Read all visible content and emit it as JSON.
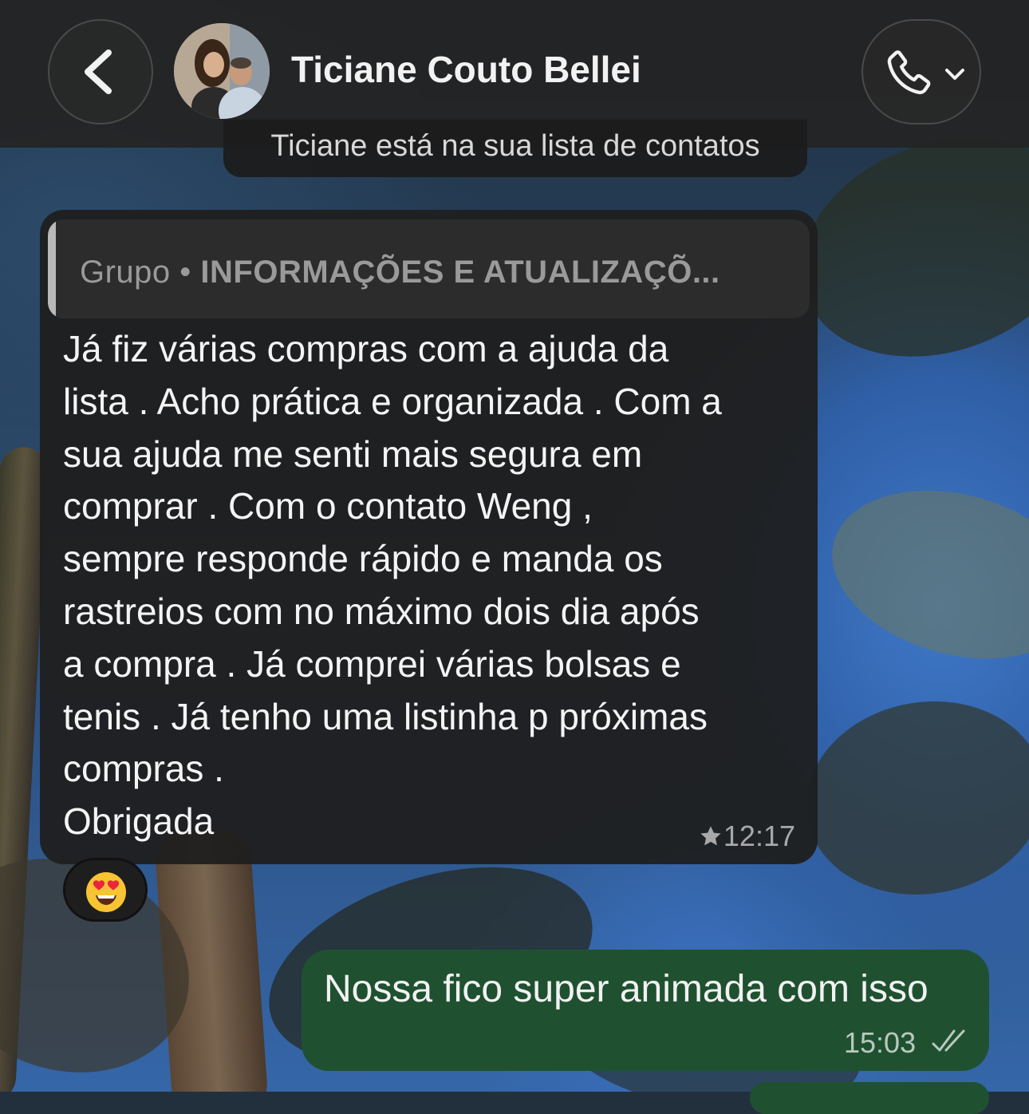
{
  "header": {
    "contact_name": "Ticiane Couto Bellei",
    "back_icon": "chevron-left-icon",
    "call_icon": "phone-icon",
    "call_menu_icon": "chevron-down-icon"
  },
  "notice": {
    "text": "Ticiane está na sua lista de contatos"
  },
  "incoming_message": {
    "quote": {
      "prefix": "Grupo",
      "separator": " • ",
      "title": "INFORMAÇÕES E ATUALIZAÇÕ..."
    },
    "text": "Já fiz várias compras com a ajuda da\nlista . Acho prática e organizada . Com a\nsua ajuda me senti mais segura em\ncomprar . Com o contato Weng ,\nsempre responde rápido e manda os\nrastreios com no máximo dois dia após\na compra . Já comprei várias bolsas e\ntenis . Já tenho uma listinha p próximas\ncompras .\nObrigada",
    "starred": true,
    "time": "12:17",
    "reaction": "heart-eyes-emoji"
  },
  "outgoing_message": {
    "text": "Nossa fico super animada com isso",
    "time": "15:03",
    "status": "read"
  },
  "colors": {
    "header_bg": "#232323",
    "incoming_bubble": "#1f1f1f",
    "outgoing_bubble": "#1f5131",
    "quote_bar": "#b9b9b9"
  }
}
